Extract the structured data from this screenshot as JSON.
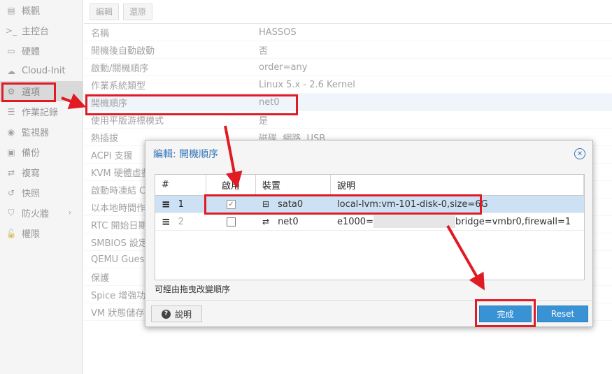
{
  "sidebar": {
    "items": [
      {
        "icon": "book-icon",
        "glyph": "▤",
        "label": "概觀",
        "faded": true
      },
      {
        "icon": "terminal-icon",
        "glyph": ">_",
        "label": "主控台",
        "faded": true
      },
      {
        "icon": "monitor-icon",
        "glyph": "▭",
        "label": "硬體",
        "faded": true
      },
      {
        "icon": "cloud-icon",
        "glyph": "☁",
        "label": "Cloud-Init",
        "faded": true
      },
      {
        "icon": "gear-icon",
        "glyph": "⚙",
        "label": "選項",
        "faded": true,
        "active": true
      },
      {
        "icon": "list-icon",
        "glyph": "☰",
        "label": "作業記錄",
        "faded": true
      },
      {
        "icon": "eye-icon",
        "glyph": "◉",
        "label": "監視器",
        "faded": true
      },
      {
        "icon": "floppy-icon",
        "glyph": "▣",
        "label": "備份",
        "faded": true
      },
      {
        "icon": "retweet-icon",
        "glyph": "⇄",
        "label": "複寫",
        "faded": true
      },
      {
        "icon": "history-icon",
        "glyph": "↺",
        "label": "快照",
        "faded": true
      },
      {
        "icon": "shield-icon",
        "glyph": "⛉",
        "label": "防火牆",
        "faded": true,
        "chevron": true
      },
      {
        "icon": "unlock-icon",
        "glyph": "🔓",
        "label": "權限",
        "faded": true
      }
    ]
  },
  "toolbar": {
    "edit_label": "編輯",
    "revert_label": "還原"
  },
  "options": {
    "rows": [
      {
        "key": "名稱",
        "value": "HASSOS"
      },
      {
        "key": "開機後自動啟動",
        "value": "否"
      },
      {
        "key": "啟動/關機順序",
        "value": "order=any"
      },
      {
        "key": "作業系統類型",
        "value": "Linux 5.x - 2.6 Kernel"
      },
      {
        "key": "開機順序",
        "value": "net0",
        "selected": true
      },
      {
        "key": "使用平版游標模式",
        "value": "是"
      },
      {
        "key": "熱插拔",
        "value": "磁碟, 網路, USB"
      },
      {
        "key": "ACPI 支援",
        "value": ""
      },
      {
        "key": "KVM 硬體虛擬化",
        "value": ""
      },
      {
        "key": "啟動時凍結 CPU",
        "value": ""
      },
      {
        "key": "以本地時間作為 RTC",
        "value": ""
      },
      {
        "key": "RTC 開始日期",
        "value": ""
      },
      {
        "key": "SMBIOS 設定",
        "value": ""
      },
      {
        "key": "QEMU Guest Agent",
        "value": ""
      },
      {
        "key": "保護",
        "value": ""
      },
      {
        "key": "Spice 增強功能",
        "value": ""
      },
      {
        "key": "VM 狀態儲存",
        "value": ""
      }
    ]
  },
  "dialog": {
    "title": "編輯: 開機順序",
    "columns": {
      "num": "#",
      "enabled": "啟用",
      "device": "裝置",
      "desc": "說明"
    },
    "rows": [
      {
        "handle": "≡",
        "num": "1",
        "checked": true,
        "dev_icon": "hdd-icon",
        "dev_glyph": "⊟",
        "device": "sata0",
        "desc": "local-lvm:vm-101-disk-0,size=6G",
        "selected": true
      },
      {
        "handle": "≡",
        "num": "2",
        "checked": false,
        "dev_icon": "exchange-icon",
        "dev_glyph": "⇄",
        "device": "net0",
        "desc_prefix": "e1000=",
        "desc_suffix": "bridge=vmbr0,firewall=1"
      }
    ],
    "hint": "可經由拖曳改變順序",
    "help_label": "說明",
    "done_label": "完成",
    "reset_label": "Reset"
  },
  "colors": {
    "accent": "#3892d4",
    "annotation": "#e01b24",
    "selection": "#cde1f4"
  }
}
